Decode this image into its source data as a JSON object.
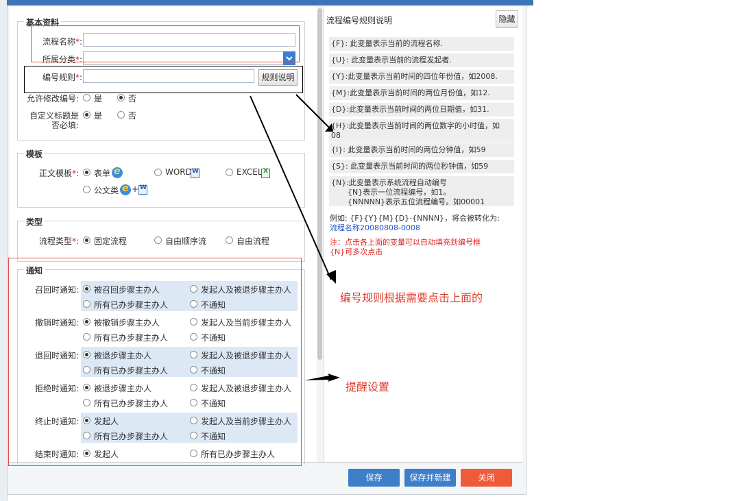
{
  "sections": {
    "basic": "基本资料",
    "template": "模板",
    "type": "类型",
    "notify": "通知"
  },
  "basic": {
    "flow_name_label": "流程名称",
    "category_label": "所属分类",
    "code_rule_label": "编号规则",
    "required_mark": "*",
    "code_rule_button": "规则说明",
    "allow_edit_label": "允许修改编号",
    "custom_title_label_1": "自定义标题是",
    "custom_title_label_2": "否必填",
    "yes": "是",
    "no": "否"
  },
  "template": {
    "label": "正文模板",
    "opt_form": "表单",
    "opt_word": "WORD",
    "opt_excel": "EXCEL",
    "opt_official": "公文类",
    "plus": "+"
  },
  "type": {
    "label": "流程类型",
    "opt_fixed": "固定流程",
    "opt_seq": "自由顺序流",
    "opt_free": "自由流程"
  },
  "notify": {
    "rows": [
      {
        "label": "召回时通知:",
        "a": "被召回步骤主办人",
        "b": "发起人及被退步骤主办人",
        "c": "所有已办步骤主办人",
        "d": "不通知"
      },
      {
        "label": "撤销时通知:",
        "a": "被撤销步骤主办人",
        "b": "发起人及当前步骤主办人",
        "c": "所有已办步骤主办人",
        "d": "不通知"
      },
      {
        "label": "退回时通知:",
        "a": "被退步骤主办人",
        "b": "发起人及被退步骤主办人",
        "c": "所有已办步骤主办人",
        "d": "不通知"
      },
      {
        "label": "拒绝时通知:",
        "a": "被退步骤主办人",
        "b": "发起人及被退步骤主办人",
        "c": "所有已办步骤主办人",
        "d": "不通知"
      },
      {
        "label": "终止时通知:",
        "a": "发起人",
        "b": "发起人及当前步骤主办人",
        "c": "所有已办步骤主办人",
        "d": "不通知"
      }
    ],
    "last": {
      "label": "结束时通知:",
      "a": "发起人",
      "b": "所有已办步骤主办人"
    }
  },
  "right": {
    "title": "流程编号规则说明",
    "hide_button": "隐藏",
    "items": [
      "{F}: 此变量表示当前的流程名称.",
      "{U}: 此变量表示当前的流程发起者.",
      "{Y}:此变量表示当前时间的四位年份值，如2008.",
      "{M}:此变量表示当前时间的两位月份值，如12.",
      "{D}:此变量表示当前时间的两位日期值，如31.",
      "{H}:此变量表示当前时间的两位数字的小时值，如",
      "08",
      "{I}: 此变量表示当前时间的两位分钟值，如59",
      "{S}: 此变量表示当前时间的两位秒钟值，如59",
      "{N}:此变量表示系统流程自动编号",
      "{N}表示一位流程编号，如1。",
      "{NNNNN}表示五位流程编号。如00001"
    ],
    "example_prefix": "例如: {F}{Y}{M}{D}-{NNNN}，将会被转化为:",
    "example_result": "流程名称20080808-0008",
    "note_1": "注：点击各上面的变量可以自动填充到编号框",
    "note_2": "{N}可多次点击"
  },
  "annotations": {
    "code_hint": "编号规则根据需要点击上面的",
    "reminder": "提醒设置"
  },
  "buttons": {
    "save": "保存",
    "save_new": "保存并新建",
    "close": "关闭"
  },
  "colors": {
    "save": "#3d7fc9",
    "close": "#ee5a3a",
    "annotation": "#e03a2a",
    "link": "#2255cc"
  }
}
